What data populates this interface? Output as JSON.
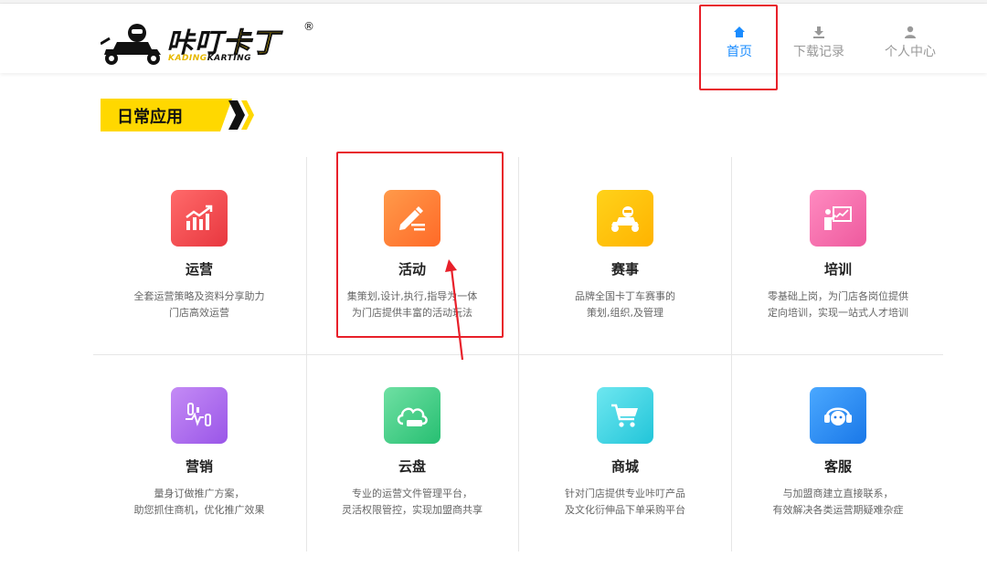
{
  "logo": {
    "brand_black": "咔叮",
    "brand_yellow": "卡丁",
    "registered": "®",
    "sub_yellow": "KADING",
    "sub_black": "KARTING"
  },
  "nav": [
    {
      "label": "首页",
      "icon": "home-icon",
      "active": true
    },
    {
      "label": "下载记录",
      "icon": "download-icon",
      "active": false
    },
    {
      "label": "个人中心",
      "icon": "user-icon",
      "active": false
    }
  ],
  "section": {
    "title": "日常应用"
  },
  "apps": [
    {
      "name": "运营",
      "icon": "chart-growth-icon",
      "desc": [
        "全套运营策略及资料分享助力",
        "门店高效运营"
      ],
      "color1": "#ff6a6a",
      "color2": "#e8373f"
    },
    {
      "name": "活动",
      "icon": "pencil-edit-icon",
      "desc": [
        "集策划,设计,执行,指导为一体",
        "为门店提供丰富的活动玩法"
      ],
      "color1": "#ff9a4a",
      "color2": "#ff6a28"
    },
    {
      "name": "赛事",
      "icon": "kart-racer-icon",
      "desc": [
        "品牌全国卡丁车赛事的",
        "策划,组织,及管理"
      ],
      "color1": "#ffd21a",
      "color2": "#ffb300"
    },
    {
      "name": "培训",
      "icon": "teacher-board-icon",
      "desc": [
        "零基础上岗，为门店各岗位提供",
        "定向培训，实现一站式人才培训"
      ],
      "color1": "#ff8ac0",
      "color2": "#ee5a9e"
    },
    {
      "name": "营销",
      "icon": "marketing-pulse-icon",
      "desc": [
        "量身订做推广方案，",
        "助您抓住商机，优化推广效果"
      ],
      "color1": "#c48bf5",
      "color2": "#9a56e8"
    },
    {
      "name": "云盘",
      "icon": "cloud-drive-icon",
      "desc": [
        "专业的运营文件管理平台，",
        "灵活权限管控，实现加盟商共享"
      ],
      "color1": "#6fe0a3",
      "color2": "#27bf72"
    },
    {
      "name": "商城",
      "icon": "shopping-cart-icon",
      "desc": [
        "针对门店提供专业咔叮产品",
        "及文化衍伸品下单采购平台"
      ],
      "color1": "#6ee7f0",
      "color2": "#22c5d9"
    },
    {
      "name": "客服",
      "icon": "headset-service-icon",
      "desc": [
        "与加盟商建立直接联系，",
        "有效解决各类运营期疑难杂症"
      ],
      "color1": "#4aa8ff",
      "color2": "#1a78e8"
    }
  ],
  "colors": {
    "accent": "#1a8cff",
    "highlight_box": "#e8202a",
    "banner": "#ffd800"
  }
}
